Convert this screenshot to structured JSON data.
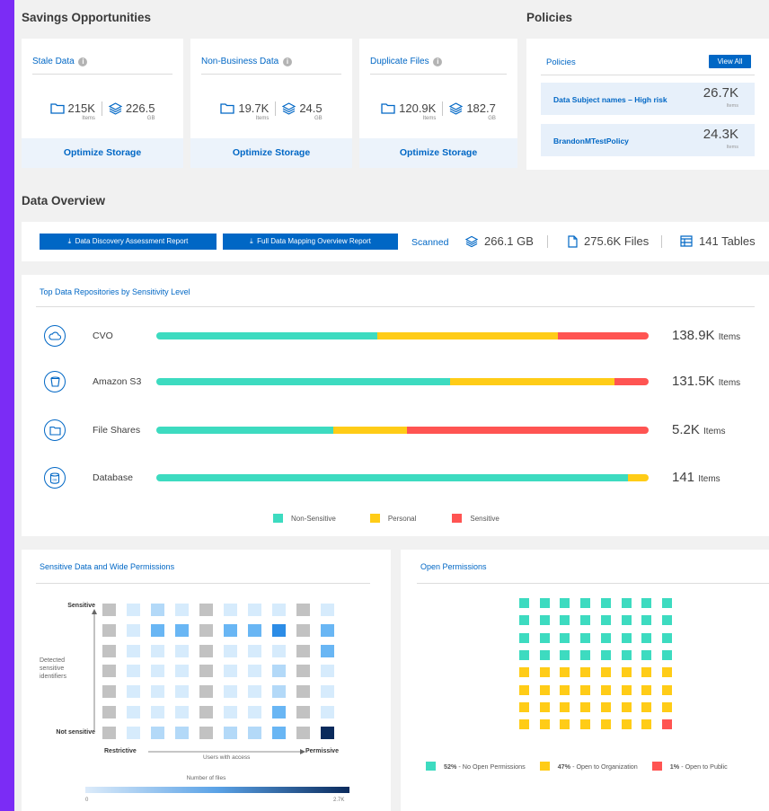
{
  "savings": {
    "section_title": "Savings Opportunities",
    "cards": [
      {
        "title": "Stale Data",
        "items": "215K",
        "items_unit": "Items",
        "size": "226.5",
        "size_unit": "GB",
        "action": "Optimize Storage"
      },
      {
        "title": "Non-Business Data",
        "items": "19.7K",
        "items_unit": "Items",
        "size": "24.5",
        "size_unit": "GB",
        "action": "Optimize Storage"
      },
      {
        "title": "Duplicate Files",
        "items": "120.9K",
        "items_unit": "Items",
        "size": "182.7",
        "size_unit": "GB",
        "action": "Optimize Storage"
      }
    ]
  },
  "policies": {
    "section_title": "Policies",
    "card_title": "Policies",
    "view_all_label": "View All",
    "rows": [
      {
        "name": "Data Subject names – High risk",
        "value": "26.7K",
        "unit": "Items"
      },
      {
        "name": "BrandonMTestPolicy",
        "value": "24.3K",
        "unit": "Items"
      }
    ]
  },
  "overview": {
    "section_title": "Data Overview",
    "report_buttons": [
      "Data Discovery Assessment Report",
      "Full Data Mapping Overview Report"
    ],
    "scanned_label": "Scanned",
    "scanned_size": "266.1 GB",
    "files": "275.6K Files",
    "tables": "141 Tables"
  },
  "repositories": {
    "title": "Top Data Repositories by Sensitivity Level",
    "rows": [
      {
        "name": "CVO",
        "icon": "cloud-icon",
        "count": "138.9K",
        "unit": "Items",
        "non_sensitive": 0.448,
        "personal": 0.367,
        "sensitive": 0.185
      },
      {
        "name": "Amazon S3",
        "icon": "bucket-icon",
        "count": "131.5K",
        "unit": "Items",
        "non_sensitive": 0.597,
        "personal": 0.333,
        "sensitive": 0.07
      },
      {
        "name": "File Shares",
        "icon": "folder-icon",
        "count": "5.2K",
        "unit": "Items",
        "non_sensitive": 0.36,
        "personal": 0.149,
        "sensitive": 0.491
      },
      {
        "name": "Database",
        "icon": "database-icon",
        "count": "141",
        "unit": "Items",
        "non_sensitive": 0.958,
        "personal": 0.042,
        "sensitive": 0
      }
    ],
    "legend": [
      "Non-Sensitive",
      "Personal",
      "Sensitive"
    ],
    "colors": {
      "non_sensitive": "#3ddbc0",
      "personal": "#ffcc17",
      "sensitive": "#ff5452"
    }
  },
  "wide_permissions": {
    "title": "Sensitive Data and Wide Permissions",
    "y_top": "Sensitive",
    "y_mid": "Detected sensitive identifiers",
    "y_bottom": "Not sensitive",
    "x_left": "Restrictive",
    "x_mid": "Users with access",
    "x_right": "Permissive",
    "scale_title": "Number of files",
    "scale_min": "0",
    "scale_max": "2.7K",
    "grid": [
      [
        "g",
        "l",
        "m",
        "l",
        "g",
        "l",
        "l",
        "l",
        "g",
        "l"
      ],
      [
        "g",
        "l",
        "M",
        "M",
        "g",
        "M",
        "M",
        "D",
        "g",
        "M"
      ],
      [
        "g",
        "l",
        "l",
        "l",
        "g",
        "l",
        "l",
        "l",
        "g",
        "M"
      ],
      [
        "g",
        "l",
        "l",
        "l",
        "g",
        "l",
        "l",
        "m",
        "g",
        "l"
      ],
      [
        "g",
        "l",
        "l",
        "l",
        "g",
        "l",
        "l",
        "m",
        "g",
        "l"
      ],
      [
        "g",
        "l",
        "l",
        "l",
        "g",
        "l",
        "l",
        "M",
        "g",
        "l"
      ],
      [
        "g",
        "l",
        "m",
        "m",
        "g",
        "m",
        "m",
        "M",
        "g",
        "N"
      ]
    ]
  },
  "open_permissions": {
    "title": "Open Permissions",
    "no_open_pct": 52,
    "org_pct": 47,
    "public_pct": 1,
    "legend": [
      {
        "pct": "52%",
        "label": "- No Open Permissions"
      },
      {
        "pct": "47%",
        "label": "- Open to Organization"
      },
      {
        "pct": "1%",
        "label": "- Open to Public"
      }
    ]
  }
}
